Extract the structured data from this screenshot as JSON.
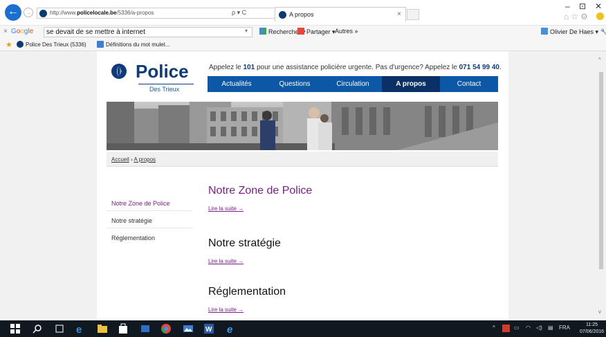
{
  "browser": {
    "url_prefix": "http://www.",
    "url_domain": "policelocale.be",
    "url_path": "/5336/a-propos",
    "address_tools": "ρ ▾ C",
    "tab_title": "A propos",
    "tab_close": "×",
    "window_controls": {
      "minimize": "–",
      "maximize": "⊡",
      "close": "✕"
    },
    "toolbar_icons": "⌂☆⚙"
  },
  "google_bar": {
    "close": "×",
    "logo": [
      "G",
      "o",
      "o",
      "g",
      "l",
      "e"
    ],
    "search_value": "se devait de se mettre à internet",
    "dropdown": "▾",
    "search_button": "Rechercher ▾",
    "share_button": "Partager ▾",
    "more_button": "Autres »",
    "user": "Olivier De Haes ▾"
  },
  "favorites": {
    "items": [
      {
        "label": "Police Des Trieux (5336)"
      },
      {
        "label": "Définitions du mot mulet..."
      }
    ]
  },
  "site": {
    "logo_text": "Police",
    "logo_subtitle": "Des Trieux",
    "emergency_pre": "Appelez le ",
    "emergency_num1": "101",
    "emergency_mid": " pour une assistance policière urgente. Pas d'urgence? Appelez le ",
    "emergency_num2": "071 54 99 40",
    "emergency_post": ".",
    "nav": [
      "Actualités",
      "Questions",
      "Circulation",
      "A propos",
      "Contact"
    ],
    "nav_active_index": 3,
    "breadcrumb": {
      "home": "Accueil",
      "separator": " › ",
      "current": "A propos"
    },
    "sidebar": [
      "Notre Zone de Police",
      "Notre stratégie",
      "Réglementation"
    ],
    "sections": [
      {
        "title": "Notre Zone de Police",
        "more": "Lire la suite →"
      },
      {
        "title": "Notre stratégie",
        "more": "Lire la suite →"
      },
      {
        "title": "Réglementation",
        "more": "Lire la suite →"
      }
    ]
  },
  "scrollbar": {
    "up": "^",
    "down": "v"
  },
  "taskbar": {
    "language": "FRA",
    "time": "11:25",
    "date": "07/06/2016"
  },
  "colors": {
    "brand_blue": "#0d3b7b",
    "nav_blue": "#0d57a7",
    "nav_active": "#0a3165",
    "link_purple": "#7a1f86"
  }
}
